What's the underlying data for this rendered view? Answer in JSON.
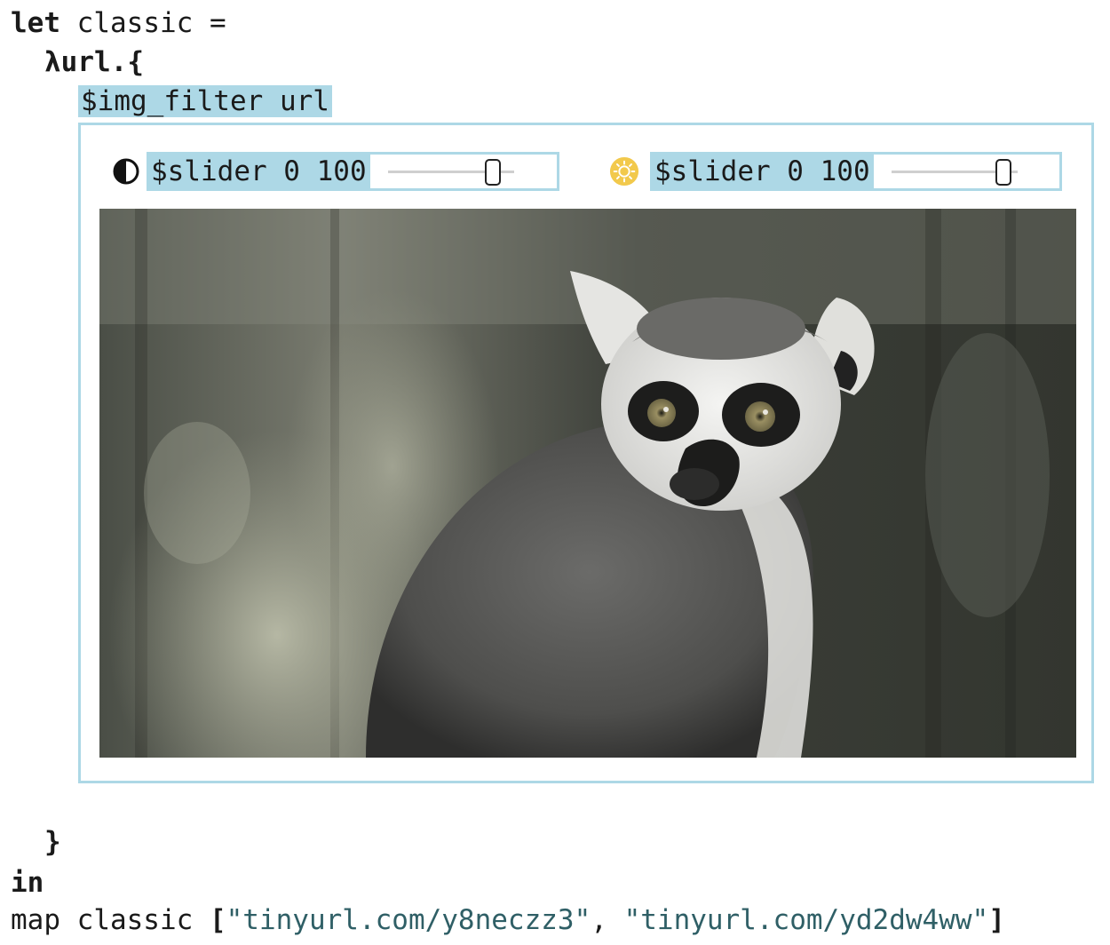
{
  "code": {
    "line1_kw": "let",
    "line1_rest": " classic =",
    "line2": "λurl.{",
    "line3": "$img_filter url",
    "line_close": "}",
    "line_in": "in",
    "map_prefix": "map classic ",
    "open_bracket": "[",
    "url1": "\"tinyurl.com/y8neczz3\"",
    "separator": ", ",
    "url2": "\"tinyurl.com/yd2dw4ww\"",
    "close_bracket": "]"
  },
  "controls": {
    "contrast": {
      "icon": "contrast-icon",
      "label": "$slider 0 100",
      "value": 83
    },
    "brightness": {
      "icon": "brightness-icon",
      "label": "$slider 0 100",
      "value": 89,
      "icon_color": "#f2c94c"
    }
  },
  "image": {
    "subject": "ring-tailed-lemur-photo"
  },
  "colors": {
    "highlight": "#add8e6",
    "string": "#2f5f66",
    "border": "#add8e6"
  }
}
